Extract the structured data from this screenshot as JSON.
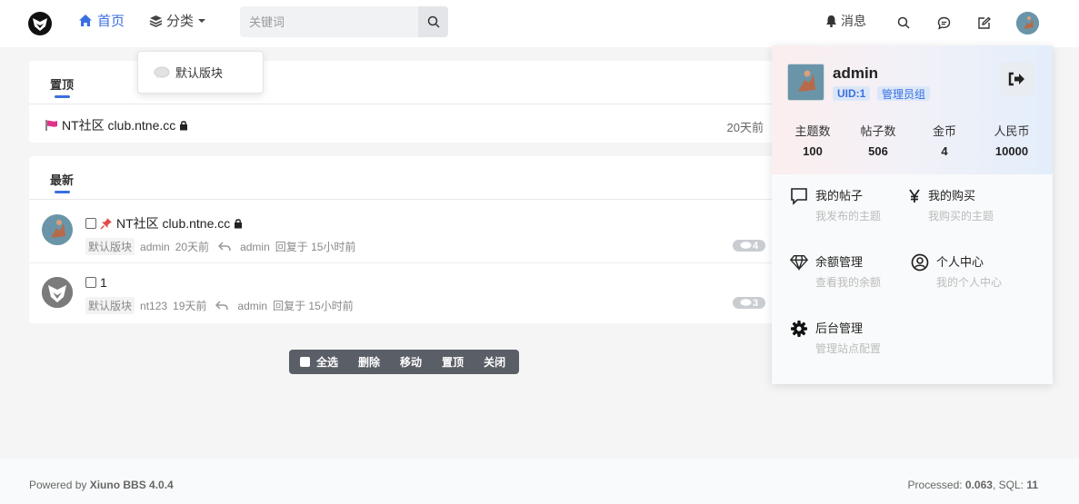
{
  "header": {
    "nav_home": "首页",
    "nav_category": "分类",
    "search_placeholder": "关键词",
    "messages": "消息"
  },
  "dropdown": {
    "item": "默认版块"
  },
  "top_section": {
    "tab": "置顶",
    "row_title": "NT社区 club.ntne.cc",
    "row_time": "20天前"
  },
  "latest_section": {
    "tab": "最新",
    "threads": [
      {
        "title": "NT社区 club.ntne.cc",
        "forum": "默认版块",
        "author": "admin",
        "created": "20天前",
        "last_user": "admin",
        "last_reply": "回复于 15小时前",
        "replies": "4"
      },
      {
        "title": "1",
        "forum": "默认版块",
        "author": "nt123",
        "created": "19天前",
        "last_user": "admin",
        "last_reply": "回复于 15小时前",
        "replies": "3"
      }
    ]
  },
  "modbar": {
    "select_all": "全选",
    "delete": "删除",
    "move": "移动",
    "sticky": "置顶",
    "close": "关闭"
  },
  "footer": {
    "powered_prefix": "Powered by ",
    "powered_name": "Xiuno BBS 4.0.4",
    "processed_label": "Processed: ",
    "processed_value": "0.063",
    "sql_label": ", SQL: ",
    "sql_value": "11"
  },
  "user_panel": {
    "username": "admin",
    "uid": "UID:1",
    "group": "管理员组",
    "stats": [
      {
        "label": "主题数",
        "value": "100"
      },
      {
        "label": "帖子数",
        "value": "506"
      },
      {
        "label": "金币",
        "value": "4"
      },
      {
        "label": "人民币",
        "value": "10000"
      }
    ],
    "menu": [
      {
        "title": "我的帖子",
        "sub": "我发布的主题"
      },
      {
        "title": "我的购买",
        "sub": "我购买的主题"
      },
      {
        "title": "余额管理",
        "sub": "查看我的余额"
      },
      {
        "title": "个人中心",
        "sub": "我的个人中心"
      },
      {
        "title": "后台管理",
        "sub": "管理站点配置"
      }
    ]
  },
  "colors": {
    "accent": "#3b6fe0",
    "modbar": "#5a5e66",
    "flag": "#e0338b",
    "pin": "#e24a4a"
  }
}
